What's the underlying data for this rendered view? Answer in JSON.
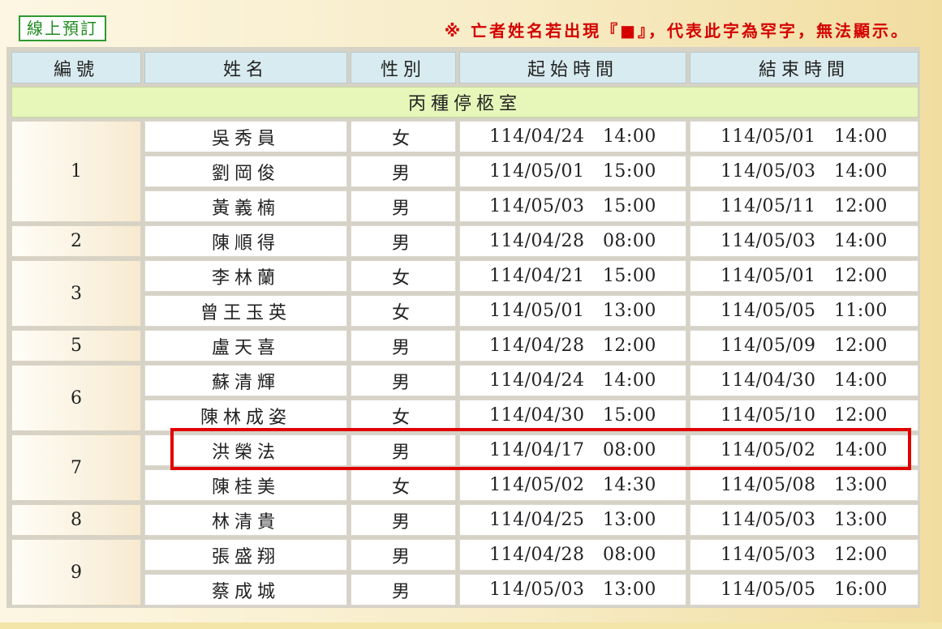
{
  "header": {
    "reserve_button": "線上預訂",
    "notice": "※ 亡者姓名若出現『■』，代表此字為罕字，無法顯示。"
  },
  "table": {
    "columns": [
      "編號",
      "姓名",
      "性別",
      "起始時間",
      "結束時間"
    ],
    "room": "丙種停柩室",
    "groups": [
      {
        "num": "1",
        "rows": [
          {
            "name": "吳秀員",
            "sex": "女",
            "start": "114/04/24   14:00",
            "end": "114/05/01   14:00"
          },
          {
            "name": "劉岡俊",
            "sex": "男",
            "start": "114/05/01   15:00",
            "end": "114/05/03   14:00"
          },
          {
            "name": "黃義楠",
            "sex": "男",
            "start": "114/05/03   15:00",
            "end": "114/05/11   12:00"
          }
        ]
      },
      {
        "num": "2",
        "rows": [
          {
            "name": "陳順得",
            "sex": "男",
            "start": "114/04/28   08:00",
            "end": "114/05/03   14:00"
          }
        ]
      },
      {
        "num": "3",
        "rows": [
          {
            "name": "李林蘭",
            "sex": "女",
            "start": "114/04/21   15:00",
            "end": "114/05/01   12:00"
          },
          {
            "name": "曾王玉英",
            "sex": "女",
            "start": "114/05/01   13:00",
            "end": "114/05/05   11:00"
          }
        ]
      },
      {
        "num": "5",
        "rows": [
          {
            "name": "盧天喜",
            "sex": "男",
            "start": "114/04/28   12:00",
            "end": "114/05/09   12:00"
          }
        ]
      },
      {
        "num": "6",
        "rows": [
          {
            "name": "蘇清輝",
            "sex": "男",
            "start": "114/04/24   14:00",
            "end": "114/04/30   14:00"
          },
          {
            "name": "陳林成姿",
            "sex": "女",
            "start": "114/04/30   15:00",
            "end": "114/05/10   12:00"
          }
        ]
      },
      {
        "num": "7",
        "rows": [
          {
            "name": "洪榮法",
            "sex": "男",
            "start": "114/04/17   08:00",
            "end": "114/05/02   14:00"
          },
          {
            "name": "陳桂美",
            "sex": "女",
            "start": "114/05/02   14:30",
            "end": "114/05/08   13:00"
          }
        ]
      },
      {
        "num": "8",
        "rows": [
          {
            "name": "林清貴",
            "sex": "男",
            "start": "114/04/25   13:00",
            "end": "114/05/03   13:00"
          }
        ]
      },
      {
        "num": "9",
        "rows": [
          {
            "name": "張盛翔",
            "sex": "男",
            "start": "114/04/28   08:00",
            "end": "114/05/03   12:00"
          },
          {
            "name": "蔡成城",
            "sex": "男",
            "start": "114/05/03   13:00",
            "end": "114/05/05   16:00"
          }
        ]
      }
    ]
  },
  "colors": {
    "header_bg": "#d8ebf0",
    "room_bg": "#e6f7b9",
    "highlight": "#e00000",
    "notice": "#d40000",
    "button": "#1f8a1f"
  }
}
